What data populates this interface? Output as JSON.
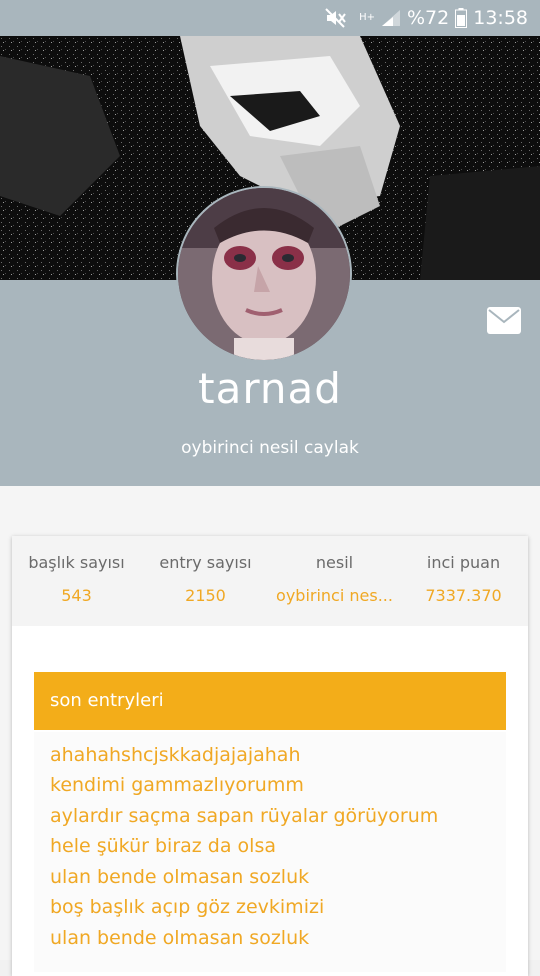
{
  "status_bar": {
    "battery_percent": "%72",
    "time": "13:58",
    "network": "H+",
    "icons": [
      "mute-icon",
      "network-hplus-icon",
      "signal-icon",
      "battery-icon"
    ]
  },
  "profile": {
    "username": "tarnad",
    "generation_label": "oybirinci nesil caylak",
    "message_icon": "envelope-icon"
  },
  "stats": [
    {
      "label": "başlık sayısı",
      "value": "543"
    },
    {
      "label": "entry sayısı",
      "value": "2150"
    },
    {
      "label": "nesil",
      "value": "oybirinci nes..."
    },
    {
      "label": "inci puan",
      "value": "7337.370"
    }
  ],
  "recent_entries": {
    "title": "son entryleri",
    "items": [
      "ahahahshcjskkadjajajahah",
      "kendimi gammazlıyorumm",
      "aylardır saçma sapan rüyalar görüyorum",
      "hele şükür biraz da olsa",
      "ulan bende olmasan sozluk",
      "boş başlık açıp göz zevkimizi",
      "ulan bende olmasan sozluk"
    ]
  },
  "colors": {
    "band": "#a9b6bd",
    "accent": "#f3ad19",
    "entry_text": "#f0a824"
  }
}
